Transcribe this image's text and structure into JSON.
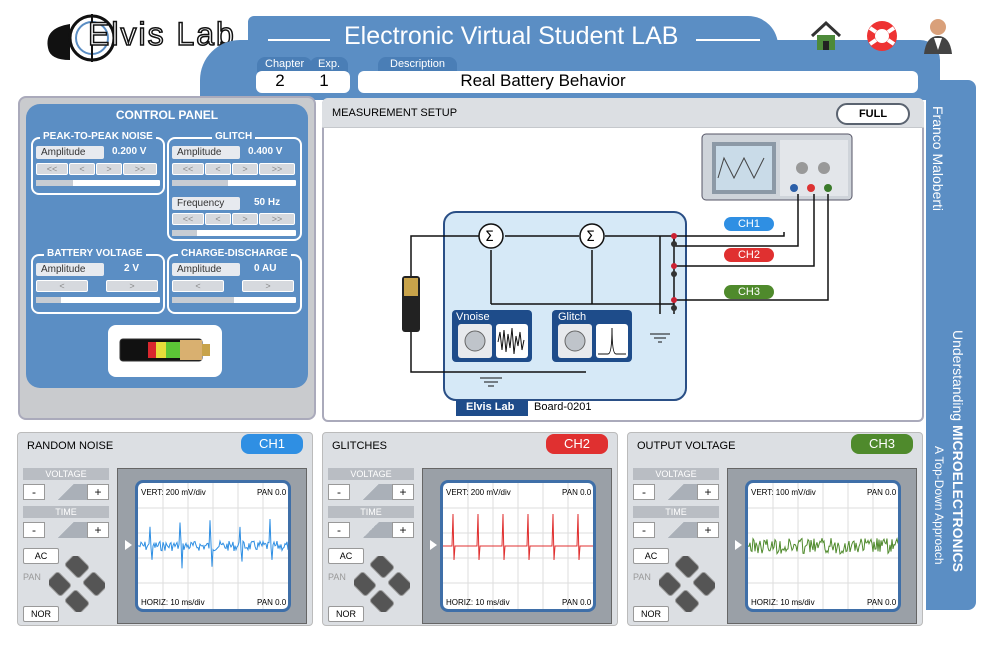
{
  "header": {
    "logo_text": "Elvis Lab",
    "title": "Electronic Virtual Student LAB",
    "chapter_label": "Chapter",
    "chapter_value": "2",
    "exp_label": "Exp.",
    "exp_value": "1",
    "description_label": "Description",
    "description_value": "Real Battery Behavior"
  },
  "top_icons": [
    "home-icon",
    "help-icon",
    "user-icon"
  ],
  "control_panel": {
    "title": "CONTROL PANEL",
    "noise": {
      "label": "PEAK-TO-PEAK NOISE",
      "field": "Amplitude",
      "value": "0.200 V",
      "buttons": [
        "<<",
        "<",
        ">",
        ">>"
      ],
      "level": 0.3
    },
    "glitch": {
      "label": "GLITCH",
      "field": "Amplitude",
      "value": "0.400 V",
      "buttons": [
        "<<",
        "<",
        ">",
        ">>"
      ],
      "level": 0.45,
      "freq_field": "Frequency",
      "freq_value": "50 Hz",
      "freq_level": 0.2
    },
    "battery": {
      "label": "BATTERY  VOLTAGE",
      "field": "Amplitude",
      "value": "2 V",
      "buttons": [
        "<",
        ">"
      ],
      "level": 0.2
    },
    "charge": {
      "label": "CHARGE-DISCHARGE",
      "field": "Amplitude",
      "value": "0 AU",
      "buttons": [
        "<",
        ">"
      ],
      "level": 0.5
    }
  },
  "measurement": {
    "title": "MEASUREMENT SETUP",
    "full_button": "FULL",
    "vnoise_label": "Vnoise",
    "glitch_label": "Glitch",
    "board_brand": "Elvis Lab",
    "board_id": "Board-0201",
    "channels": [
      "CH1",
      "CH2",
      "CH3"
    ]
  },
  "colors": {
    "ch1": "#2f8fe3",
    "ch2": "#e03030",
    "ch3": "#4f8a2c",
    "accent": "#5b8ec4"
  },
  "sidebar": {
    "author": "Franco Maloberti",
    "book_prefix": "Understanding ",
    "book_title": "MICROELECTRONICS",
    "book_subtitle": "A Top-Down Approach"
  },
  "scopes": [
    {
      "title": "RANDOM NOISE",
      "channel": "CH1",
      "vert": "VERT: 200 mV/div",
      "pan": "PAN 0.0",
      "horiz": "HORIZ:  10 ms/div",
      "pan_bottom": "PAN 0.0",
      "voltage_label": "VOLTAGE",
      "time_label": "TIME",
      "minus": "-",
      "plus": "+",
      "ac_button": "AC",
      "pan_label": "PAN",
      "nor_button": "NOR"
    },
    {
      "title": "GLITCHES",
      "channel": "CH2",
      "vert": "VERT: 200 mV/div",
      "pan": "PAN 0.0",
      "horiz": "HORIZ:  10 ms/div",
      "pan_bottom": "PAN 0.0",
      "voltage_label": "VOLTAGE",
      "time_label": "TIME",
      "minus": "-",
      "plus": "+",
      "ac_button": "AC",
      "pan_label": "PAN",
      "nor_button": "NOR"
    },
    {
      "title": "OUTPUT VOLTAGE",
      "channel": "CH3",
      "vert": "VERT: 100 mV/div",
      "pan": "PAN 0.0",
      "horiz": "HORIZ:  10 ms/div",
      "pan_bottom": "PAN 0.0",
      "voltage_label": "VOLTAGE",
      "time_label": "TIME",
      "minus": "-",
      "plus": "+",
      "ac_button": "AC",
      "pan_label": "PAN",
      "nor_button": "NOR"
    }
  ]
}
